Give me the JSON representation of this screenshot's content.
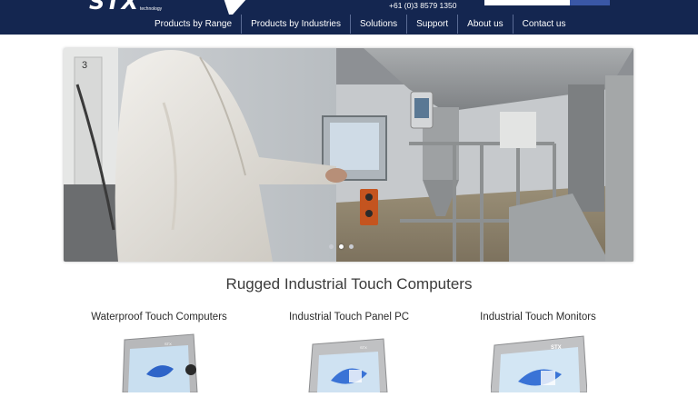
{
  "header": {
    "logo_text": "STX",
    "logo_subtext": "technology",
    "phone": "+61 (0)3 8579 1350",
    "nav": [
      {
        "label": "Products by Range"
      },
      {
        "label": "Products by Industries"
      },
      {
        "label": "Solutions"
      },
      {
        "label": "Support"
      },
      {
        "label": "About us"
      },
      {
        "label": "Contact us"
      }
    ]
  },
  "hero": {
    "sign_number": "3",
    "slide_indicator": {
      "count": 3,
      "active_index": 1
    }
  },
  "main": {
    "heading": "Rugged Industrial Touch Computers",
    "categories": [
      {
        "label": "Waterproof Touch Computers"
      },
      {
        "label": "Industrial Touch Panel PC"
      },
      {
        "label": "Industrial Touch Monitors"
      }
    ],
    "product_badge": "STX"
  },
  "colors": {
    "header_bg": "#142650",
    "search_button": "#3a57a6",
    "heading_text": "#3b3b3b"
  }
}
